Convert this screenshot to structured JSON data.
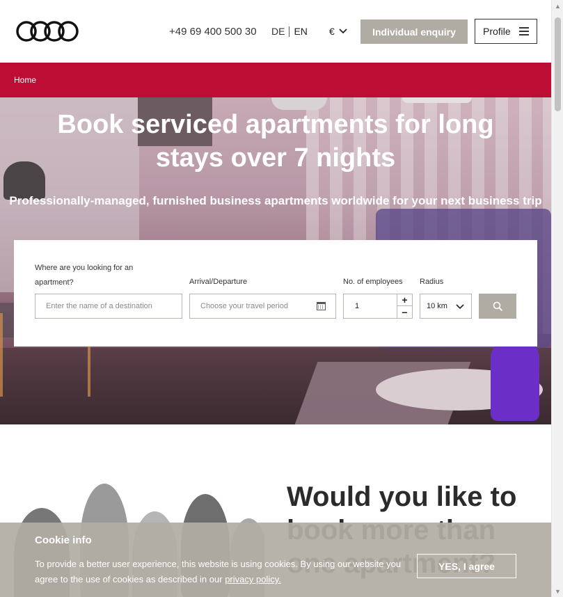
{
  "header": {
    "logo_icon": "four-rings-logo",
    "phone": "+49 69 400 500 30",
    "languages": [
      "DE",
      "EN"
    ],
    "currency": "€",
    "enquiry_button": "Individual enquiry",
    "profile_button": "Profile",
    "menu_icon": "hamburger-icon"
  },
  "breadcrumb": {
    "items": [
      "Home"
    ]
  },
  "hero": {
    "title": "Book serviced apartments for long stays over 7 nights",
    "subtitle": "Professionally-managed, furnished business apartments worldwide for your next business trip"
  },
  "search": {
    "destination_label": "Where are you looking for an apartment?",
    "destination_placeholder": "Enter the name of a destination",
    "dates_label": "Arrival/Departure",
    "dates_placeholder": "Choose your travel period",
    "employees_label": "No. of employees",
    "employees_value": "1",
    "radius_label": "Radius",
    "radius_value": "10 km",
    "increment": "+",
    "decrement": "−"
  },
  "promo": {
    "title": "Would you like to book more than one apartment?"
  },
  "cookie": {
    "title": "Cookie info",
    "text": "To provide a better user experience, this website is using cookies. By using our website you agree to the use of cookies as described in our",
    "link": "privacy policy.",
    "agree_button": "YES, I agree"
  },
  "colors": {
    "brand_red": "#bd0d35",
    "button_grey": "#b0aca4"
  }
}
